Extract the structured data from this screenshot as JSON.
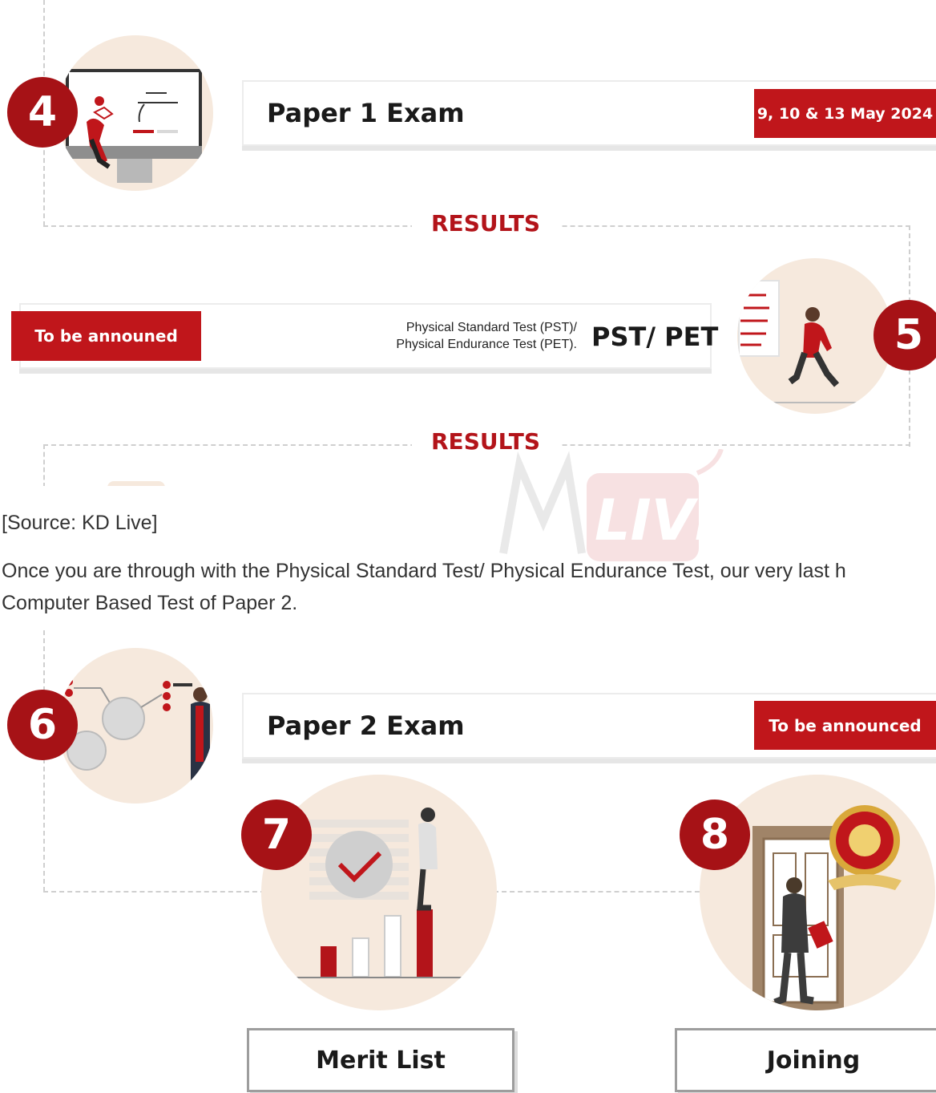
{
  "steps": {
    "four": {
      "number": "4",
      "title": "Paper 1 Exam",
      "date": "9, 10 & 13 May  2024"
    },
    "results1": "RESULTS",
    "five": {
      "number": "5",
      "status": "To be announed",
      "description_line1": "Physical Standard Test (PST)/",
      "description_line2": "Physical Endurance Test (PET).",
      "title": "PST/ PET"
    },
    "results2": "RESULTS",
    "six": {
      "number": "6",
      "title": "Paper 2 Exam",
      "status": "To be announced"
    },
    "seven": {
      "number": "7",
      "label": "Merit List"
    },
    "eight": {
      "number": "8",
      "label": "Joining"
    }
  },
  "source": "[Source: KD Live]",
  "paragraph": {
    "line1": "Once you are through with the Physical Standard Test/ Physical Endurance Test, our very last h",
    "line2": "Computer Based Test of Paper 2."
  },
  "watermark": "LIVE",
  "colors": {
    "accent": "#c0161b",
    "badge": "#a61216",
    "circle_bg": "#f6e9dd",
    "dash": "#cfcfcf"
  }
}
